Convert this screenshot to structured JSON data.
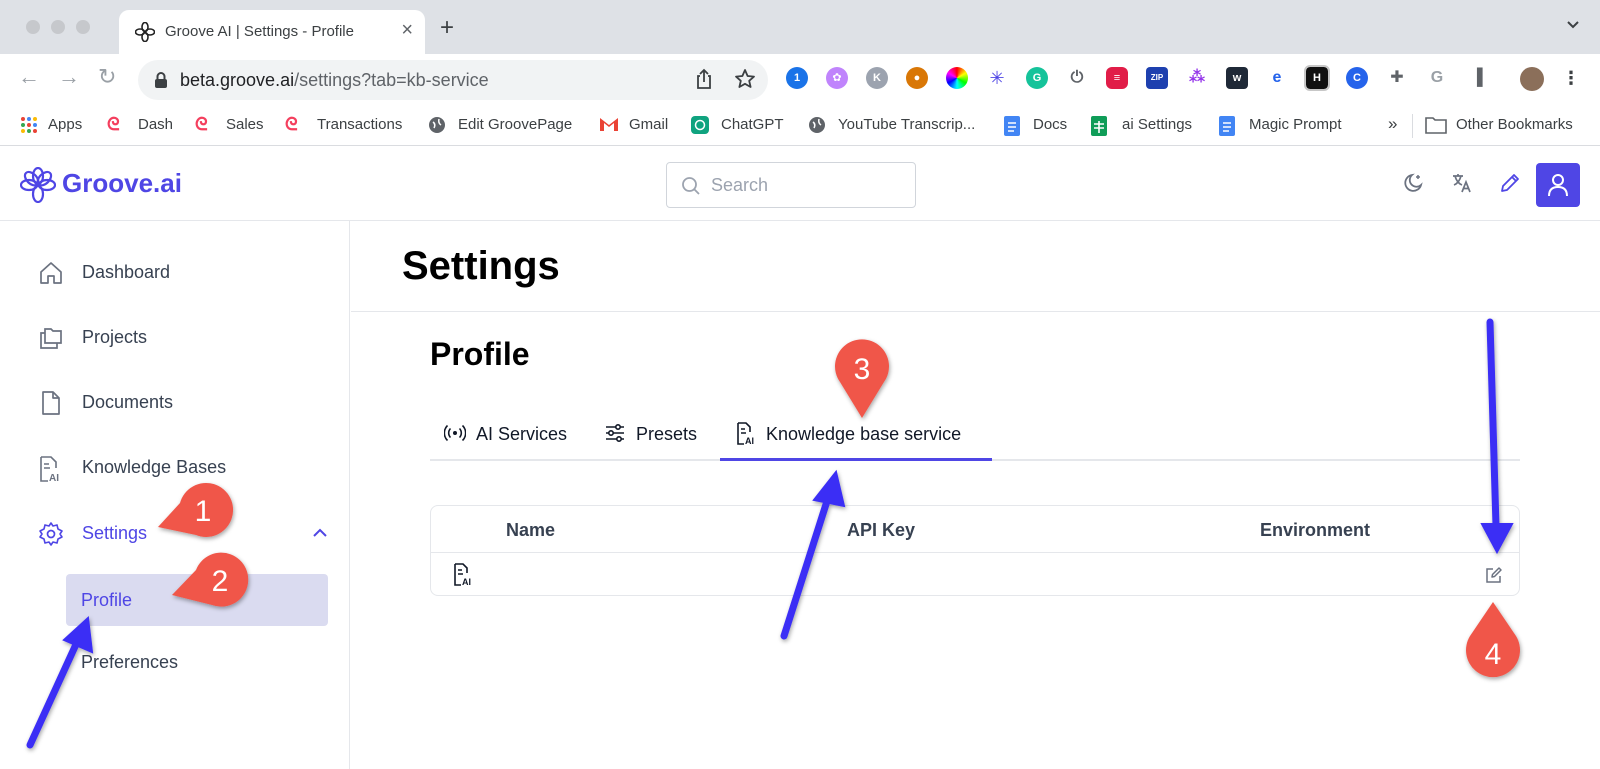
{
  "browser": {
    "tab_title": "Groove AI | Settings - Profile",
    "url_host": "beta.groove.ai",
    "url_path": "/settings?tab=kb-service",
    "bookmarks": [
      {
        "label": "Apps"
      },
      {
        "label": "Dash"
      },
      {
        "label": "Sales"
      },
      {
        "label": "Transactions"
      },
      {
        "label": "Edit GroovePage"
      },
      {
        "label": "Gmail"
      },
      {
        "label": "ChatGPT"
      },
      {
        "label": "YouTube Transcrip..."
      },
      {
        "label": "Docs"
      },
      {
        "label": "ai Settings"
      },
      {
        "label": "Magic Prompt"
      },
      {
        "label": "Other Bookmarks"
      }
    ],
    "more_bookmarks": "»"
  },
  "app": {
    "logo": "Groove.ai",
    "search_placeholder": "Search",
    "accent": "#4f46e5"
  },
  "sidebar": {
    "items": [
      {
        "label": "Dashboard",
        "icon": "home-icon"
      },
      {
        "label": "Projects",
        "icon": "folders-icon"
      },
      {
        "label": "Documents",
        "icon": "document-icon"
      },
      {
        "label": "Knowledge Bases",
        "icon": "knowledge-base-icon"
      },
      {
        "label": "Settings",
        "icon": "gear-icon"
      }
    ],
    "subitems": [
      {
        "label": "Profile"
      },
      {
        "label": "Preferences"
      }
    ]
  },
  "main": {
    "title": "Settings",
    "section_title": "Profile",
    "tabs": [
      {
        "label": "AI Services",
        "icon": "broadcast-icon"
      },
      {
        "label": "Presets",
        "icon": "sliders-icon"
      },
      {
        "label": "Knowledge base service",
        "icon": "knowledge-base-icon"
      }
    ],
    "table": {
      "headers": [
        "Name",
        "API Key",
        "Environment"
      ]
    }
  },
  "annotations": {
    "markers": [
      "1",
      "2",
      "3",
      "4"
    ],
    "marker_color": "#f0564a",
    "arrow_color": "#3b2ff5"
  }
}
